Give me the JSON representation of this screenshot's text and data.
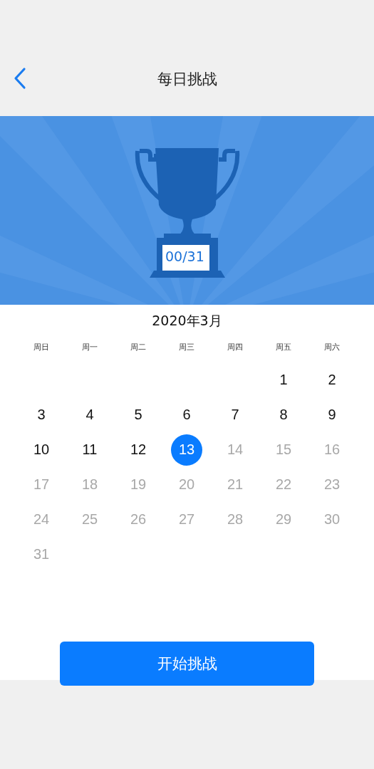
{
  "header": {
    "title": "每日挑战"
  },
  "banner": {
    "progress": "00/31"
  },
  "calendar": {
    "month": "2020年3月",
    "weekdays": [
      "周日",
      "周一",
      "周二",
      "周三",
      "周四",
      "周五",
      "周六"
    ],
    "weeks": [
      [
        {
          "day": "1",
          "selected": false,
          "disabled": false
        },
        {
          "day": "2",
          "selected": false,
          "disabled": false
        }
      ],
      [
        {
          "day": "3",
          "selected": false,
          "disabled": false
        },
        {
          "day": "4",
          "selected": false,
          "disabled": false
        },
        {
          "day": "5",
          "selected": false,
          "disabled": false
        },
        {
          "day": "6",
          "selected": false,
          "disabled": false
        },
        {
          "day": "7",
          "selected": false,
          "disabled": false
        },
        {
          "day": "8",
          "selected": false,
          "disabled": false
        },
        {
          "day": "9",
          "selected": false,
          "disabled": false
        }
      ],
      [
        {
          "day": "10",
          "selected": false,
          "disabled": false
        },
        {
          "day": "11",
          "selected": false,
          "disabled": false
        },
        {
          "day": "12",
          "selected": false,
          "disabled": false
        },
        {
          "day": "13",
          "selected": true,
          "disabled": false
        },
        {
          "day": "14",
          "selected": false,
          "disabled": true
        },
        {
          "day": "15",
          "selected": false,
          "disabled": true
        },
        {
          "day": "16",
          "selected": false,
          "disabled": true
        }
      ],
      [
        {
          "day": "17",
          "selected": false,
          "disabled": true
        },
        {
          "day": "18",
          "selected": false,
          "disabled": true
        },
        {
          "day": "19",
          "selected": false,
          "disabled": true
        },
        {
          "day": "20",
          "selected": false,
          "disabled": true
        },
        {
          "day": "21",
          "selected": false,
          "disabled": true
        },
        {
          "day": "22",
          "selected": false,
          "disabled": true
        },
        {
          "day": "23",
          "selected": false,
          "disabled": true
        }
      ],
      [
        {
          "day": "24",
          "selected": false,
          "disabled": true
        },
        {
          "day": "25",
          "selected": false,
          "disabled": true
        },
        {
          "day": "26",
          "selected": false,
          "disabled": true
        },
        {
          "day": "27",
          "selected": false,
          "disabled": true
        },
        {
          "day": "28",
          "selected": false,
          "disabled": true
        },
        {
          "day": "29",
          "selected": false,
          "disabled": true
        },
        {
          "day": "30",
          "selected": false,
          "disabled": true
        }
      ],
      [
        {
          "day": "31",
          "selected": false,
          "disabled": true
        }
      ]
    ]
  },
  "start_button": "开始挑战"
}
